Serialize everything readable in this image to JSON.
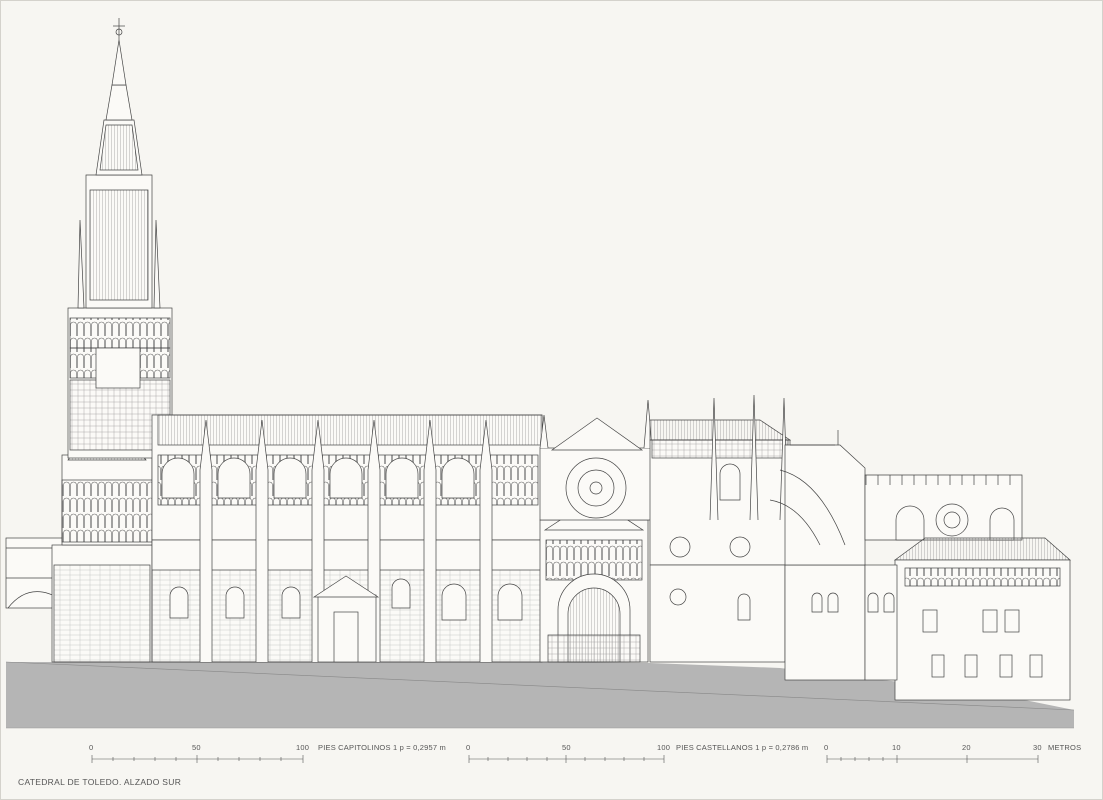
{
  "title": "CATEDRAL DE TOLEDO. ALZADO SUR",
  "scale_bars": [
    {
      "unit_label": "PIES CAPITOLINOS 1 p = 0,2957 m",
      "ticks": [
        "0",
        "50",
        "100"
      ]
    },
    {
      "unit_label": "PIES CASTELLANOS 1 p = 0,2786 m",
      "ticks": [
        "0",
        "50",
        "100"
      ]
    },
    {
      "unit_label": "METROS",
      "ticks": [
        "0",
        "10",
        "20",
        "30"
      ]
    }
  ],
  "colors": {
    "background": "#f7f6f2",
    "ground": "#b5b5b5",
    "line": "#444444",
    "frame": "#d4d2cc"
  }
}
